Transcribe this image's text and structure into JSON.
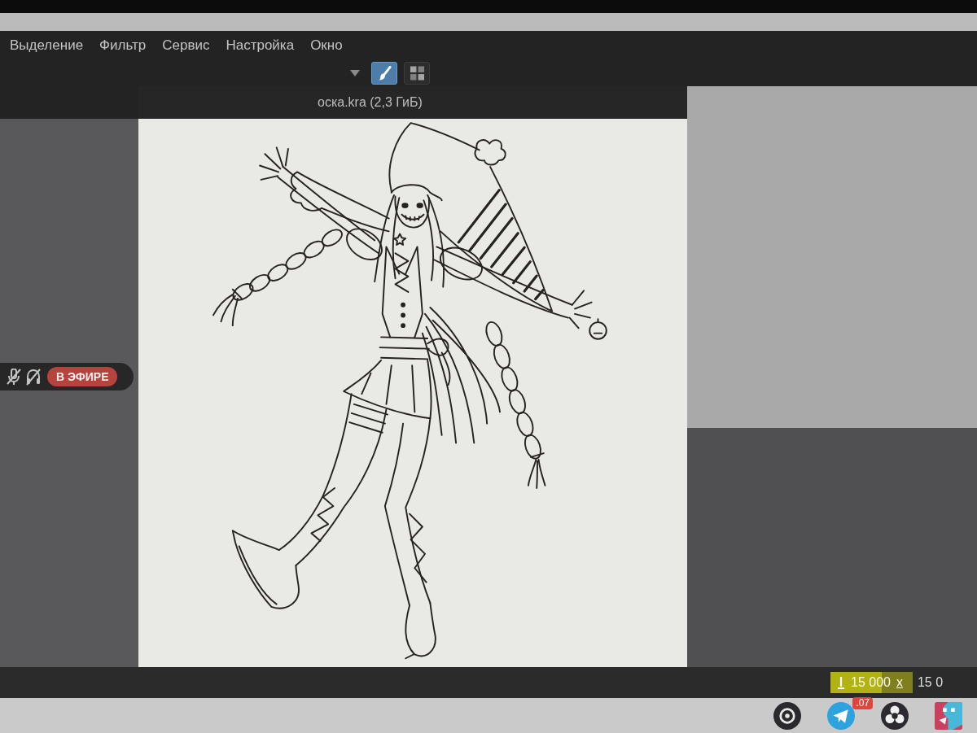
{
  "menu": [
    {
      "label": "Выделение"
    },
    {
      "label": "Фильтр"
    },
    {
      "label": "Сервис"
    },
    {
      "label": "Настройка"
    },
    {
      "label": "Окно"
    }
  ],
  "toolbar_buttons": [
    {
      "kind": "brush",
      "selected": true
    },
    {
      "kind": "squares",
      "selected": false
    }
  ],
  "document_tab": {
    "title": "оска.kra (2,3 ГиБ)"
  },
  "voice_overlay": {
    "mic_muted": true,
    "sound_muted": true,
    "live_label": "В ЭФИРЕ"
  },
  "status_bar": {
    "canvas_width": "15 000",
    "separator": "x",
    "canvas_height": "15 0"
  },
  "taskbar": [
    {
      "kind": "ring"
    },
    {
      "kind": "plane",
      "badge": ".07"
    },
    {
      "kind": "swirl"
    },
    {
      "kind": "tile"
    }
  ]
}
